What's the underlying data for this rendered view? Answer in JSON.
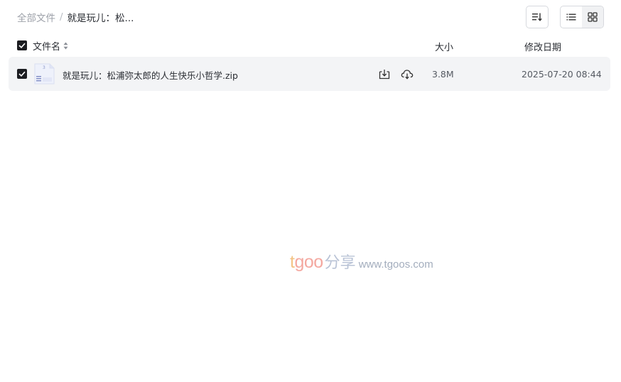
{
  "breadcrumb": {
    "root": "全部文件",
    "separator": "/",
    "current": "就是玩儿：松..."
  },
  "toolbar": {
    "sort_icon": "sort-list-icon",
    "view_list_icon": "list-view-icon",
    "view_grid_icon": "grid-view-icon",
    "active_view": "list"
  },
  "table": {
    "headers": {
      "name": "文件名",
      "size": "大小",
      "date": "修改日期"
    },
    "header_checked": true,
    "rows": [
      {
        "checked": true,
        "icon": "zip-file-icon",
        "name": "就是玩儿：松浦弥太郎的人生快乐小哲学.zip",
        "actions": [
          "download-icon",
          "cloud-save-icon"
        ],
        "size": "3.8M",
        "date": "2025-07-20 08:44"
      }
    ]
  },
  "watermark": {
    "brand_t": "t",
    "brand_goo": "goo",
    "brand_cn": "分享",
    "url": "www.tgoos.com"
  },
  "colors": {
    "row_bg": "#f3f4f6",
    "checkbox": "#1c1d21",
    "muted_text": "#9da1a9"
  }
}
